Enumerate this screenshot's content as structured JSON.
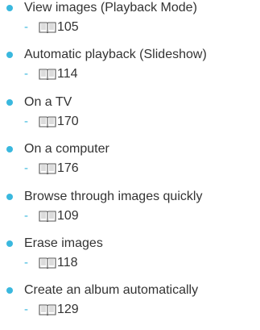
{
  "colors": {
    "bullet": "#3ab8de",
    "dash": "#3ab8de",
    "text": "#333333"
  },
  "icon": "book-icon",
  "items": [
    {
      "title": "View images (Playback Mode)",
      "dash": "-",
      "page": "105"
    },
    {
      "title": "Automatic playback (Slideshow)",
      "dash": "-",
      "page": "114"
    },
    {
      "title": "On a TV",
      "dash": "-",
      "page": "170"
    },
    {
      "title": "On a computer",
      "dash": "-",
      "page": "176"
    },
    {
      "title": "Browse through images quickly",
      "dash": "-",
      "page": "109"
    },
    {
      "title": "Erase images",
      "dash": "-",
      "page": "118"
    },
    {
      "title": "Create an album automatically",
      "dash": "-",
      "page": "129"
    }
  ]
}
